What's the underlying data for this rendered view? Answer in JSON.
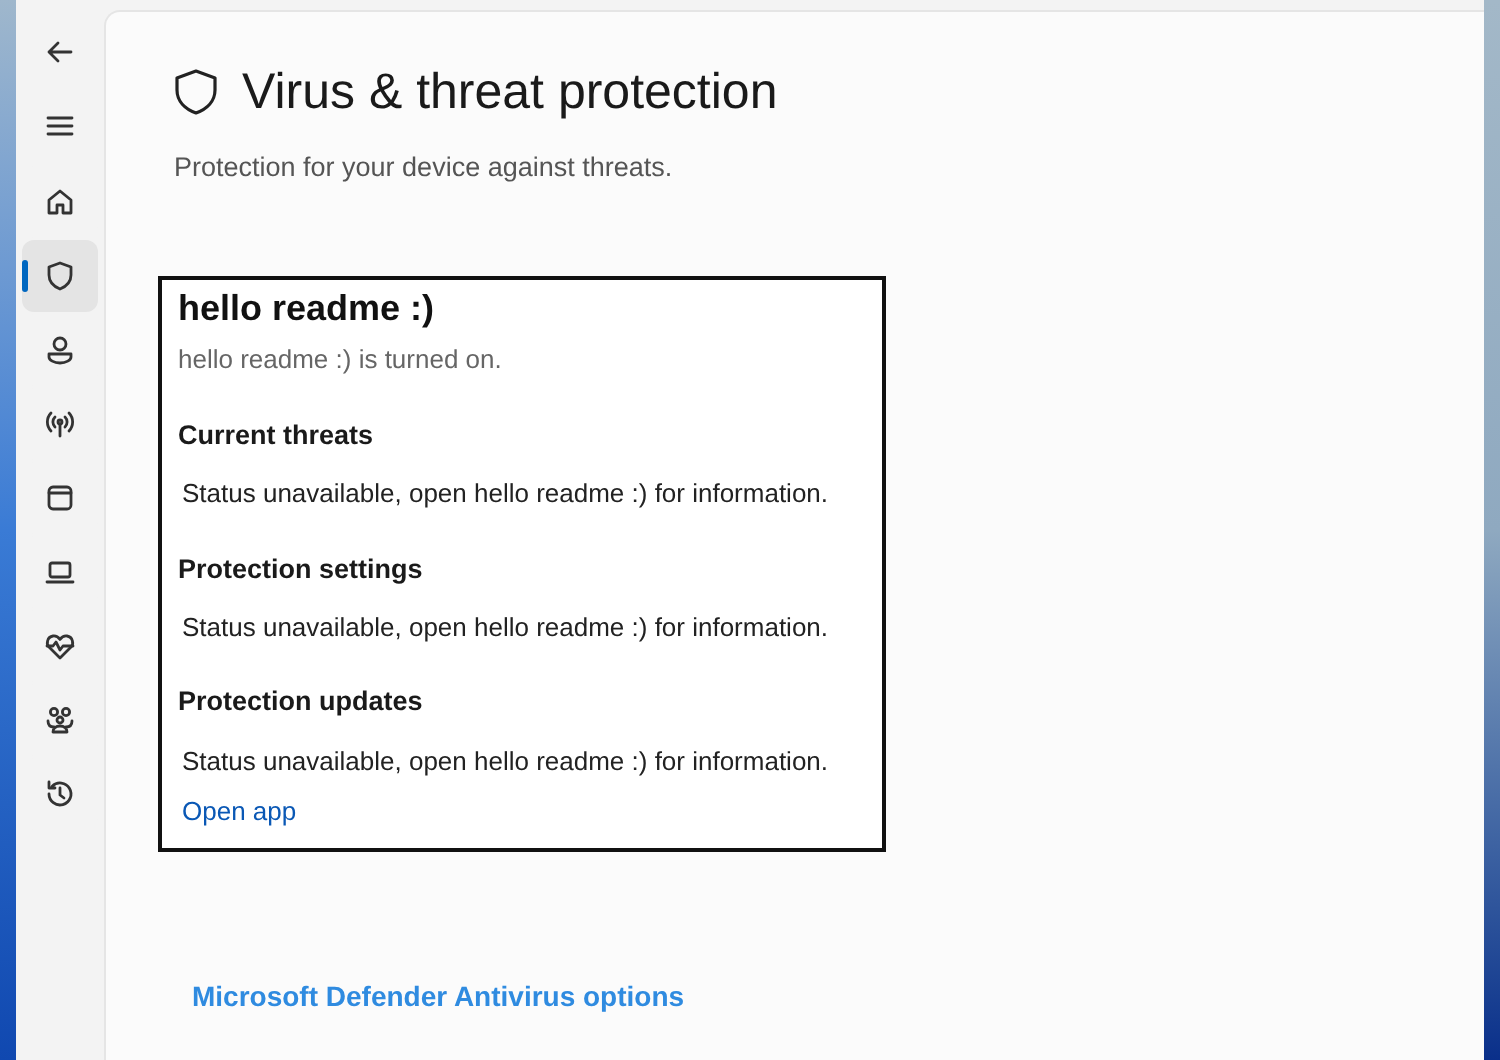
{
  "sidebar": {
    "items": [
      {
        "selected": false
      },
      {
        "selected": true
      },
      {
        "selected": false
      },
      {
        "selected": false
      },
      {
        "selected": false
      },
      {
        "selected": false
      },
      {
        "selected": false
      },
      {
        "selected": false
      },
      {
        "selected": false
      }
    ]
  },
  "page": {
    "title": "Virus & threat protection",
    "subtitle": "Protection for your device against threats."
  },
  "provider_card": {
    "name": "hello readme :)",
    "status": "hello readme :) is turned on.",
    "sections": [
      {
        "heading": "Current threats",
        "text": "Status unavailable, open hello readme :) for information."
      },
      {
        "heading": "Protection settings",
        "text": "Status unavailable, open hello readme :) for information."
      },
      {
        "heading": "Protection updates",
        "text": "Status unavailable, open hello readme :) for information."
      }
    ],
    "link": "Open app"
  },
  "options_link": "Microsoft Defender Antivirus options"
}
